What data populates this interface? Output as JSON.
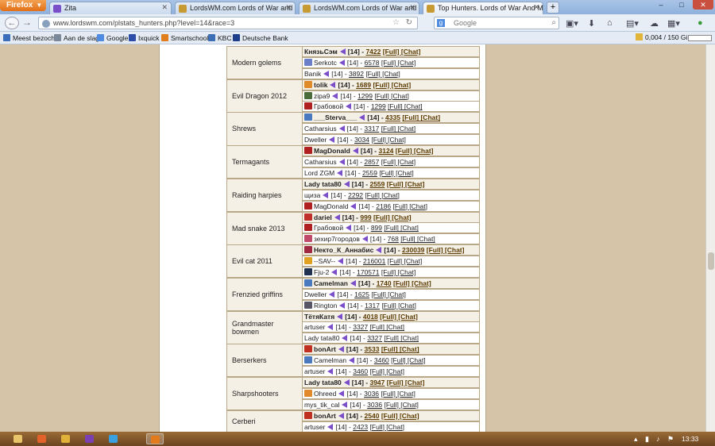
{
  "browser": {
    "app_button": "Firefox",
    "tabs": [
      {
        "label": "Zita",
        "color": "#7b4fc9"
      },
      {
        "label": "LordsWM.com Lords of War and Mo...",
        "color": "#c79a34"
      },
      {
        "label": "LordsWM.com Lords of War and Mo...",
        "color": "#c79a34"
      },
      {
        "label": "Top Hunters. Lords of War And Mone...",
        "color": "#c79a34",
        "active": true
      }
    ],
    "new_tab": "+",
    "url": "www.lordswm.com/plstats_hunters.php?level=14&race=3",
    "search_placeholder": "Google",
    "search_engine_letter": "g",
    "window_controls": {
      "min": "–",
      "max": "□",
      "close": "✕"
    }
  },
  "bookmarks": [
    {
      "label": "Meest bezocht",
      "color": "#3b6dbb"
    },
    {
      "label": "Aan de slag",
      "color": "#7a8899"
    },
    {
      "label": "Google",
      "color": "#4f8be0"
    },
    {
      "label": "Ixquick",
      "color": "#2c4ea8"
    },
    {
      "label": "Smartschool",
      "color": "#e07d1c"
    },
    {
      "label": "KBC",
      "color": "#3c6fb6"
    },
    {
      "label": "Deutsche Bank",
      "color": "#1d3f8a"
    }
  ],
  "storage": "0,004 / 150 GiB",
  "hunters": [
    {
      "monster": "Modern golems",
      "rows": [
        {
          "name": "КнязьСэм",
          "level": "[14]",
          "score": "7422",
          "links": "[Full] [Chat]",
          "flag": "",
          "top": true
        },
        {
          "name": "Serkotc",
          "level": "[14]",
          "score": "6578",
          "links": "[Full] [Chat]",
          "flag": "#6b7fc9"
        },
        {
          "name": "Banik",
          "level": "[14]",
          "score": "3892",
          "links": "[Full] [Chat]",
          "flag": ""
        }
      ]
    },
    {
      "monster": "Evil Dragon 2012",
      "rows": [
        {
          "name": "tolik",
          "level": "[14]",
          "score": "1689",
          "links": "[Full] [Chat]",
          "flag": "#e08a2a",
          "top": true
        },
        {
          "name": "zipa9",
          "level": "[14]",
          "score": "1299",
          "links": "[Full] [Chat]",
          "flag": "#4a6b3a"
        },
        {
          "name": "Грабовой",
          "level": "[14]",
          "score": "1299",
          "links": "[Full] [Chat]",
          "flag": "#b02020"
        }
      ]
    },
    {
      "monster": "Shrews",
      "rows": [
        {
          "name": "___Sterva___",
          "level": "[14]",
          "score": "4335",
          "links": "[Full] [Chat]",
          "flag": "#4a79c0",
          "top": true
        },
        {
          "name": "Catharsius",
          "level": "[14]",
          "score": "3317",
          "links": "[Full] [Chat]",
          "flag": ""
        },
        {
          "name": "Dweller",
          "level": "[14]",
          "score": "3034",
          "links": "[Full] [Chat]",
          "flag": ""
        }
      ]
    },
    {
      "monster": "Termagants",
      "rows": [
        {
          "name": "MagDonald",
          "level": "[14]",
          "score": "3124",
          "links": "[Full] [Chat]",
          "flag": "#b02020",
          "top": true
        },
        {
          "name": "Catharsius",
          "level": "[14]",
          "score": "2857",
          "links": "[Full] [Chat]",
          "flag": ""
        },
        {
          "name": "Lord ZGM",
          "level": "[14]",
          "score": "2559",
          "links": "[Full] [Chat]",
          "flag": ""
        }
      ]
    },
    {
      "monster": "Raiding harpies",
      "rows": [
        {
          "name": "Lady tata80",
          "level": "[14]",
          "score": "2559",
          "links": "[Full] [Chat]",
          "flag": "",
          "top": true
        },
        {
          "name": "щиза",
          "level": "[14]",
          "score": "2292",
          "links": "[Full] [Chat]",
          "flag": ""
        },
        {
          "name": "MagDonald",
          "level": "[14]",
          "score": "2186",
          "links": "[Full] [Chat]",
          "flag": "#b02020"
        }
      ]
    },
    {
      "monster": "Mad snake 2013",
      "rows": [
        {
          "name": "dariel",
          "level": "[14]",
          "score": "999",
          "links": "[Full] [Chat]",
          "flag": "#c0302a",
          "top": true
        },
        {
          "name": "Грабовой",
          "level": "[14]",
          "score": "899",
          "links": "[Full] [Chat]",
          "flag": "#b02020"
        },
        {
          "name": "зехир7городов",
          "level": "[14]",
          "score": "768",
          "links": "[Full] [Chat]",
          "flag": "#c04a6a"
        }
      ]
    },
    {
      "monster": "Evil cat 2011",
      "rows": [
        {
          "name": "Некто_К_Аннабис",
          "level": "[14]",
          "score": "230039",
          "links": "[Full] [Chat]",
          "flag": "#a02840",
          "top": true
        },
        {
          "name": "--SAV--",
          "level": "[14]",
          "score": "216001",
          "links": "[Full] [Chat]",
          "flag": "#e0a020"
        },
        {
          "name": "Fju-2",
          "level": "[14]",
          "score": "170571",
          "links": "[Full] [Chat]",
          "flag": "#203050"
        }
      ]
    },
    {
      "monster": "Frenzied griffins",
      "rows": [
        {
          "name": "Camelman",
          "level": "[14]",
          "score": "1740",
          "links": "[Full] [Chat]",
          "flag": "#4a79c0",
          "top": true
        },
        {
          "name": "Dweller",
          "level": "[14]",
          "score": "1625",
          "links": "[Full] [Chat]",
          "flag": ""
        },
        {
          "name": "Rington",
          "level": "[14]",
          "score": "1317",
          "links": "[Full] [Chat]",
          "flag": "#556"
        }
      ]
    },
    {
      "monster": "Grandmaster bowmen",
      "rows": [
        {
          "name": "ТётяКатя",
          "level": "[14]",
          "score": "4018",
          "links": "[Full] [Chat]",
          "flag": "",
          "top": true
        },
        {
          "name": "artuser",
          "level": "[14]",
          "score": "3327",
          "links": "[Full] [Chat]",
          "flag": ""
        },
        {
          "name": "Lady tata80",
          "level": "[14]",
          "score": "3327",
          "links": "[Full] [Chat]",
          "flag": ""
        }
      ]
    },
    {
      "monster": "Berserkers",
      "rows": [
        {
          "name": "bonArt",
          "level": "[14]",
          "score": "3533",
          "links": "[Full] [Chat]",
          "flag": "#c03020",
          "top": true
        },
        {
          "name": "Camelman",
          "level": "[14]",
          "score": "3460",
          "links": "[Full] [Chat]",
          "flag": "#4a79c0"
        },
        {
          "name": "artuser",
          "level": "[14]",
          "score": "3460",
          "links": "[Full] [Chat]",
          "flag": ""
        }
      ]
    },
    {
      "monster": "Sharpshooters",
      "rows": [
        {
          "name": "Lady tata80",
          "level": "[14]",
          "score": "3947",
          "links": "[Full] [Chat]",
          "flag": "",
          "top": true
        },
        {
          "name": "Ohreed",
          "level": "[14]",
          "score": "3036",
          "links": "[Full] [Chat]",
          "flag": "#e08a2a"
        },
        {
          "name": "mys_tik_cal",
          "level": "[14]",
          "score": "3036",
          "links": "[Full] [Chat]",
          "flag": ""
        }
      ]
    },
    {
      "monster": "Cerberi",
      "rows": [
        {
          "name": "bonArt",
          "level": "[14]",
          "score": "2540",
          "links": "[Full] [Chat]",
          "flag": "#c03020",
          "top": true
        },
        {
          "name": "artuser",
          "level": "[14]",
          "score": "2423",
          "links": "[Full] [Chat]",
          "flag": ""
        }
      ]
    }
  ],
  "taskbar": {
    "apps": [
      {
        "name": "explorer",
        "color": "#e8c56a"
      },
      {
        "name": "firefox-old",
        "color": "#e2622a"
      },
      {
        "name": "media",
        "color": "#e0b23a"
      },
      {
        "name": "game",
        "color": "#7a3fb0"
      },
      {
        "name": "ie",
        "color": "#3aa0e0"
      },
      {
        "name": "firefox",
        "color": "#e37a1c",
        "active": true
      }
    ],
    "clock": "13:33"
  }
}
